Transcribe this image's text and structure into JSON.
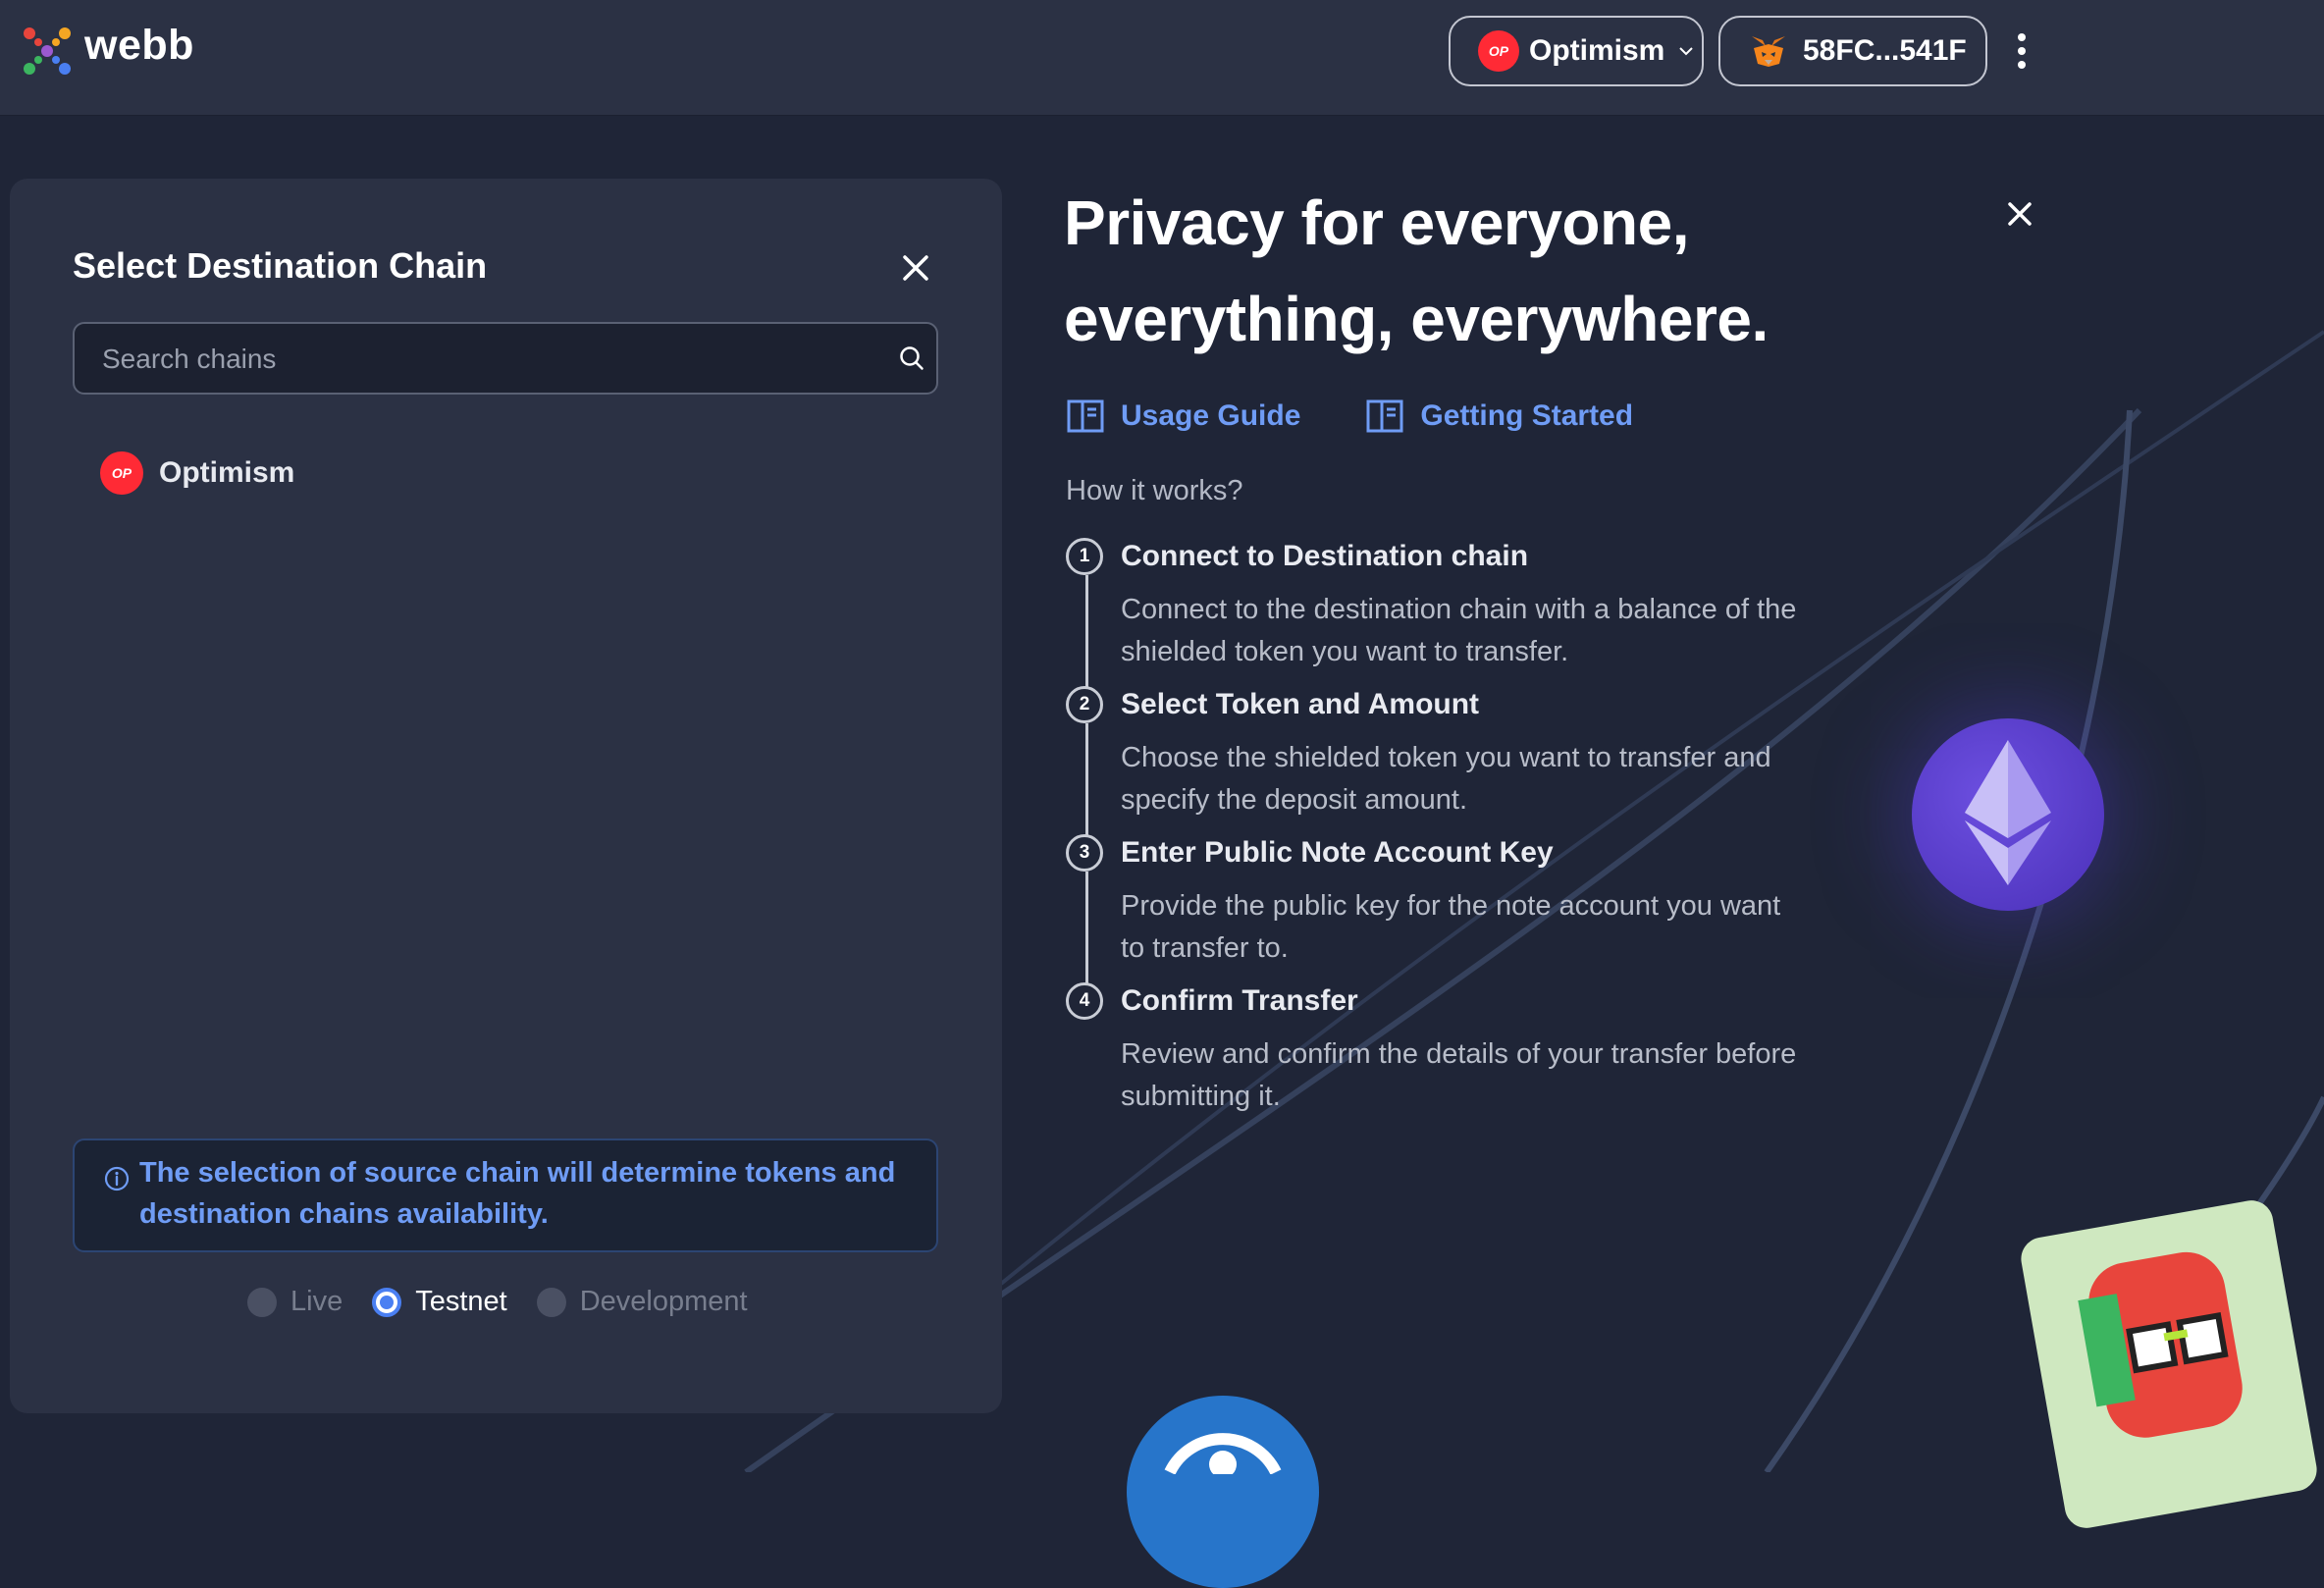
{
  "header": {
    "brand": "webb",
    "network": {
      "label": "Optimism",
      "badge": "OP"
    },
    "wallet": {
      "address": "58FC...541F"
    }
  },
  "panel": {
    "title": "Select Destination Chain",
    "search": {
      "placeholder": "Search chains",
      "value": ""
    },
    "chains": [
      {
        "label": "Optimism",
        "badge": "OP"
      }
    ],
    "info": "The selection of source chain will determine tokens and destination chains availability.",
    "modes": [
      {
        "label": "Live",
        "selected": false
      },
      {
        "label": "Testnet",
        "selected": true
      },
      {
        "label": "Development",
        "selected": false
      }
    ]
  },
  "hero": {
    "line1": "Privacy for everyone,",
    "line2": "everything, everywhere.",
    "links": [
      {
        "label": "Usage Guide"
      },
      {
        "label": "Getting Started"
      }
    ],
    "how_title": "How it works?",
    "steps": [
      {
        "num": "1",
        "title": "Connect to Destination chain",
        "desc": "Connect to the destination chain with a balance of the shielded token you want to transfer."
      },
      {
        "num": "2",
        "title": "Select Token and Amount",
        "desc": "Choose the shielded token you want to transfer and specify the deposit amount."
      },
      {
        "num": "3",
        "title": "Enter Public Note Account Key",
        "desc": "Provide the public key for the note account you want to transfer to."
      },
      {
        "num": "4",
        "title": "Confirm Transfer",
        "desc": "Review and confirm the details of your transfer before submitting it."
      }
    ]
  },
  "colors": {
    "background": "#1f2537",
    "panel": "#2b3144",
    "accent_blue": "#6f9cf5",
    "optimism_red": "#ff2a35"
  }
}
